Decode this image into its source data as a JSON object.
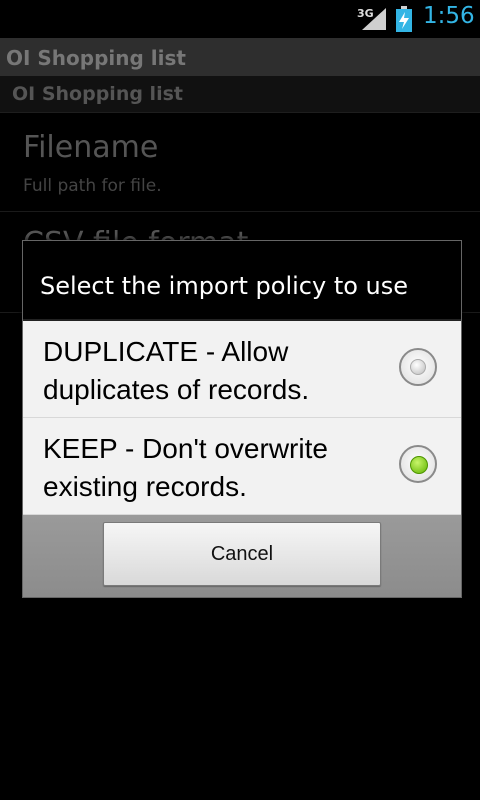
{
  "status_bar": {
    "network": "3G",
    "time": "1:56",
    "icons": [
      "signal-icon",
      "battery-charging-icon"
    ],
    "time_color": "#33b5e5"
  },
  "app": {
    "title": "OI Shopping list",
    "subtitle": "OI Shopping list"
  },
  "preferences": [
    {
      "title": "Filename",
      "summary": "Full path for file."
    },
    {
      "title": "CSV file format",
      "summary": ""
    }
  ],
  "dialog": {
    "title": "Select the import policy to use",
    "options": [
      {
        "label": "DUPLICATE - Allow duplicates of records.",
        "selected": false
      },
      {
        "label": "KEEP - Don't overwrite existing records.",
        "selected": true
      }
    ],
    "cancel_label": "Cancel",
    "selected_color": "#7ed321"
  }
}
